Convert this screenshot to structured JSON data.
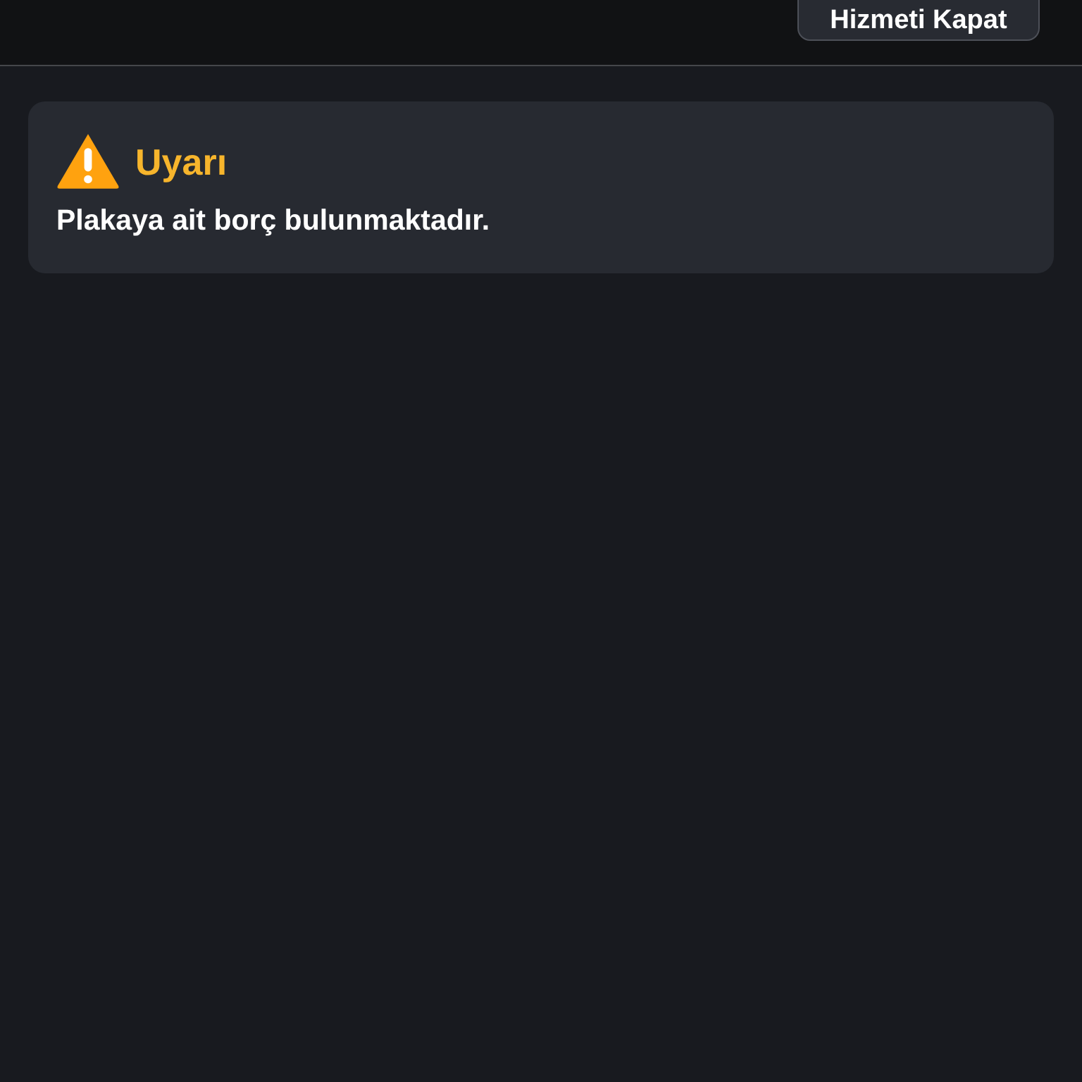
{
  "header": {
    "close_service_button": "Hizmeti Kapat"
  },
  "alert": {
    "kind": "warning",
    "title": "Uyarı",
    "message": "Plakaya ait borç bulunmaktadır."
  }
}
